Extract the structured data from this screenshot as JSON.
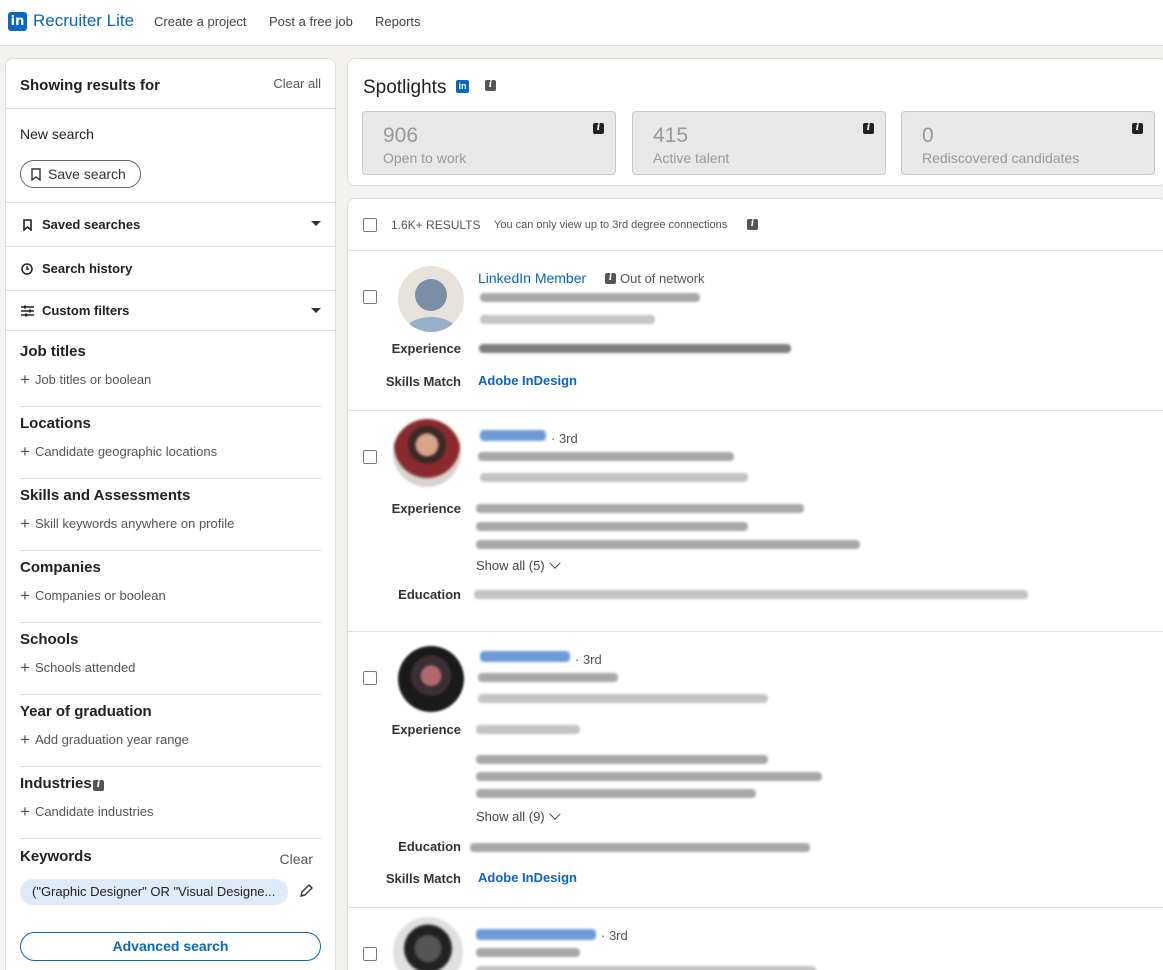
{
  "nav": {
    "logo_letters": "in",
    "product": "Recruiter Lite",
    "links": [
      "Create a project",
      "Post a free job",
      "Reports"
    ]
  },
  "sidebar": {
    "title": "Showing results for",
    "clear_all": "Clear all",
    "new_search": "New search",
    "save_search": "Save search",
    "saved_searches": "Saved searches",
    "search_history": "Search history",
    "custom_filters": "Custom filters",
    "filters": [
      {
        "title": "Job titles",
        "add": "Job titles or boolean"
      },
      {
        "title": "Locations",
        "add": "Candidate geographic locations"
      },
      {
        "title": "Skills and Assessments",
        "add": "Skill keywords anywhere on profile"
      },
      {
        "title": "Companies",
        "add": "Companies or boolean"
      },
      {
        "title": "Schools",
        "add": "Schools attended"
      },
      {
        "title": "Year of graduation",
        "add": "Add graduation year range"
      },
      {
        "title": "Industries",
        "add": "Candidate industries"
      }
    ],
    "keywords_title": "Keywords",
    "keywords_clear": "Clear",
    "keywords_value": "(\"Graphic Designer\" OR \"Visual Designe...",
    "advanced_search": "Advanced search"
  },
  "spotlights": {
    "title": "Spotlights",
    "cards": [
      {
        "value": "906",
        "label": "Open to work"
      },
      {
        "value": "415",
        "label": "Active talent"
      },
      {
        "value": "0",
        "label": "Rediscovered candidates"
      }
    ]
  },
  "results": {
    "count": "1.6K+ RESULTS",
    "note": "You can only view up to 3rd degree connections",
    "candidates": [
      {
        "name": "LinkedIn Member",
        "network": "Out of network",
        "experience_label": "Experience",
        "skills_label": "Skills Match",
        "skill": "Adobe InDesign"
      },
      {
        "degree": "· 3rd",
        "experience_label": "Experience",
        "show_all": "Show all (5)",
        "education_label": "Education"
      },
      {
        "degree": "· 3rd",
        "experience_label": "Experience",
        "show_all": "Show all (9)",
        "education_label": "Education",
        "skills_label": "Skills Match",
        "skill": "Adobe InDesign"
      },
      {
        "degree": "· 3rd"
      }
    ]
  },
  "colors": {
    "brand": "#0a66c2",
    "pill": "#ddeaf7"
  }
}
